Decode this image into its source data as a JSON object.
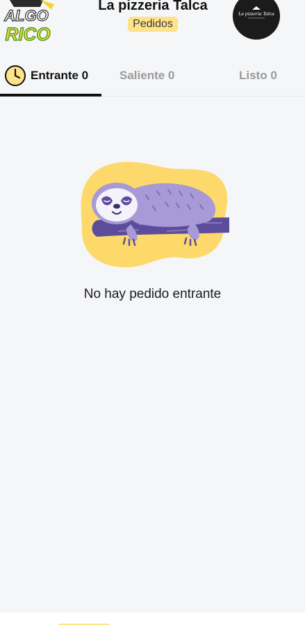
{
  "header": {
    "logo_text_top": "ALGO",
    "logo_text_bottom": "RICO",
    "restaurant_name": "La pizzeria Talca",
    "section_badge": "Pedidos",
    "avatar_text": "La pizzeria Talca"
  },
  "tabs": [
    {
      "label": "Entrante 0",
      "active": true,
      "icon": "clock-icon"
    },
    {
      "label": "Saliente 0",
      "active": false
    },
    {
      "label": "Listo 0",
      "active": false
    }
  ],
  "empty_state": {
    "illustration": "sleeping-sloth",
    "message": "No hay pedido entrante"
  },
  "colors": {
    "accent_yellow": "#fde38a",
    "logo_yellow": "#f6d531",
    "logo_green": "#4a9a2c",
    "sloth_purple": "#a79ad6",
    "branch_purple": "#5d4c9c",
    "background": "#f5f6f8"
  }
}
